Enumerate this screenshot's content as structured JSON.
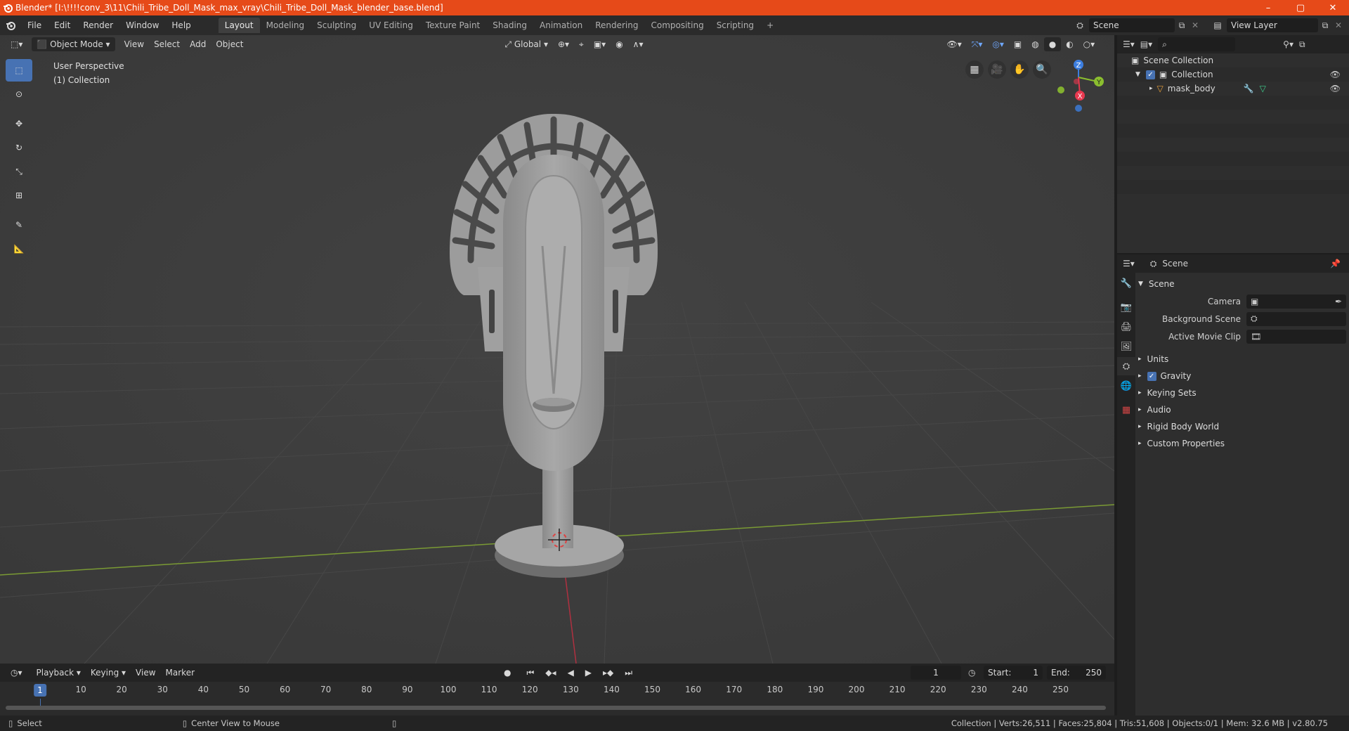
{
  "window": {
    "title": "Blender* [I:\\!!!!conv_3\\11\\Chili_Tribe_Doll_Mask_max_vray\\Chili_Tribe_Doll_Mask_blender_base.blend]",
    "minimize": "–",
    "maximize": "▢",
    "close": "✕"
  },
  "menu": [
    "File",
    "Edit",
    "Render",
    "Window",
    "Help"
  ],
  "workspaces": [
    "Layout",
    "Modeling",
    "Sculpting",
    "UV Editing",
    "Texture Paint",
    "Shading",
    "Animation",
    "Rendering",
    "Compositing",
    "Scripting"
  ],
  "add_workspace": "+",
  "scene_selector": "Scene",
  "view_layer": "View Layer",
  "viewport": {
    "mode": "Object Mode",
    "menus": [
      "View",
      "Select",
      "Add",
      "Object"
    ],
    "orientation": "Global",
    "info_line1": "User Perspective",
    "info_line2": "(1) Collection",
    "axes": {
      "x": "X",
      "y": "Y",
      "z": "Z"
    }
  },
  "outliner": {
    "search_placeholder": "",
    "scene_collection": "Scene Collection",
    "collection": "Collection",
    "object": "mask_body"
  },
  "properties": {
    "header": "Scene",
    "section": "Scene",
    "fields": [
      {
        "label": "Camera",
        "value": ""
      },
      {
        "label": "Background Scene",
        "value": ""
      },
      {
        "label": "Active Movie Clip",
        "value": ""
      }
    ],
    "subsections": [
      "Units",
      "Gravity",
      "Keying Sets",
      "Audio",
      "Rigid Body World",
      "Custom Properties"
    ]
  },
  "timeline": {
    "menus": [
      "Playback",
      "Keying",
      "View",
      "Marker"
    ],
    "current_frame": "1",
    "start_label": "Start:",
    "start": "1",
    "end_label": "End:",
    "end": "250",
    "ticks": [
      "10",
      "20",
      "30",
      "40",
      "50",
      "60",
      "70",
      "80",
      "90",
      "100",
      "110",
      "120",
      "130",
      "140",
      "150",
      "160",
      "170",
      "180",
      "190",
      "200",
      "210",
      "220",
      "230",
      "240",
      "250"
    ]
  },
  "status": {
    "left1": "Select",
    "left2": "Center View to Mouse",
    "right": "Collection | Verts:26,511 | Faces:25,804 | Tris:51,608 | Objects:0/1 | Mem: 32.6 MB | v2.80.75"
  },
  "colors": {
    "titlebar": "#e64a19",
    "accent": "#4772b3",
    "viewport_bg": "#3d3d3d",
    "x_axis": "#e8384f",
    "y_axis": "#8bbe2f",
    "z_axis": "#3c7ee0"
  }
}
